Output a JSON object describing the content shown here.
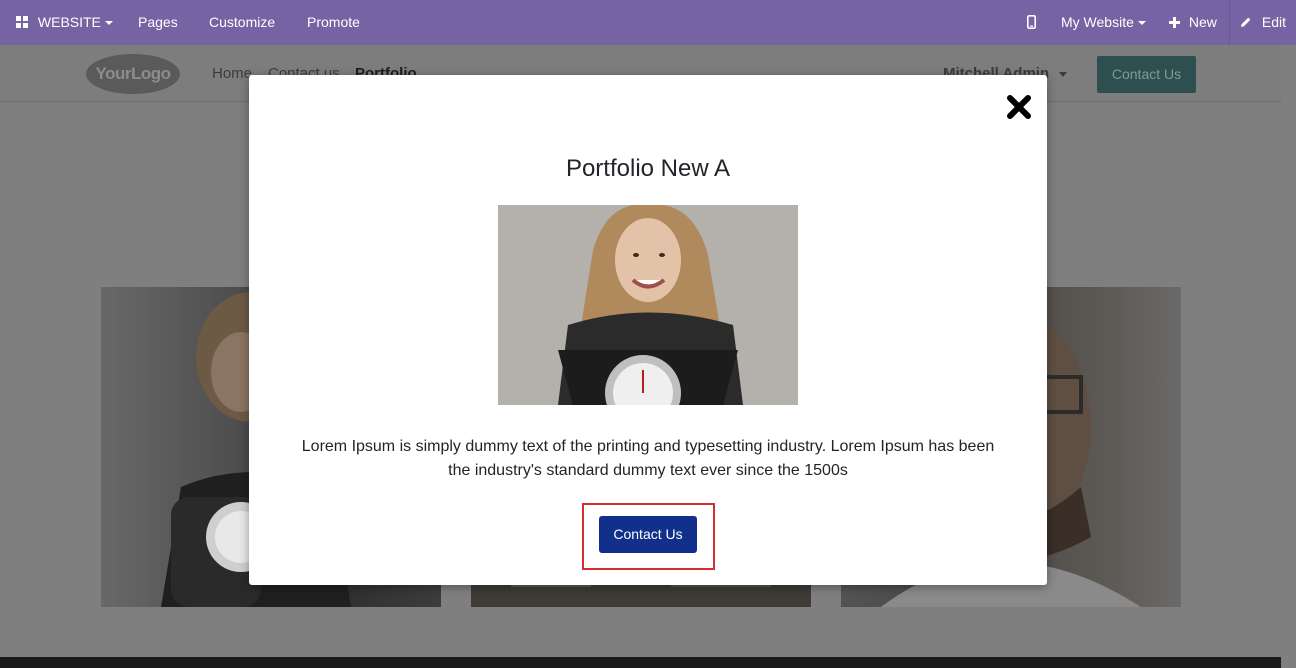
{
  "topbar": {
    "website_menu": "WEBSITE",
    "pages": "Pages",
    "customize": "Customize",
    "promote": "Promote",
    "site_selector": "My Website",
    "new": "New",
    "edit": "Edit"
  },
  "site_header": {
    "logo_text": "YourLogo",
    "nav": [
      "Home",
      "Contact us",
      "Portfolio"
    ],
    "user": "Mitchell Admin",
    "cta": "Contact Us"
  },
  "modal": {
    "title": "Portfolio New A",
    "description": "Lorem Ipsum is simply dummy text of the printing and typesetting industry. Lorem Ipsum has been the industry's standard dummy text ever since the 1500s",
    "cta": "Contact Us"
  },
  "colors": {
    "admin_bar": "#7563a3",
    "modal_button": "#10308c",
    "highlight": "#d32f2f",
    "header_button": "#2d4f50"
  },
  "icons": {
    "apps": "apps-grid-icon",
    "mobile": "mobile-phone-icon",
    "new": "plus-icon",
    "edit": "pencil-icon",
    "close": "close-x-icon"
  }
}
